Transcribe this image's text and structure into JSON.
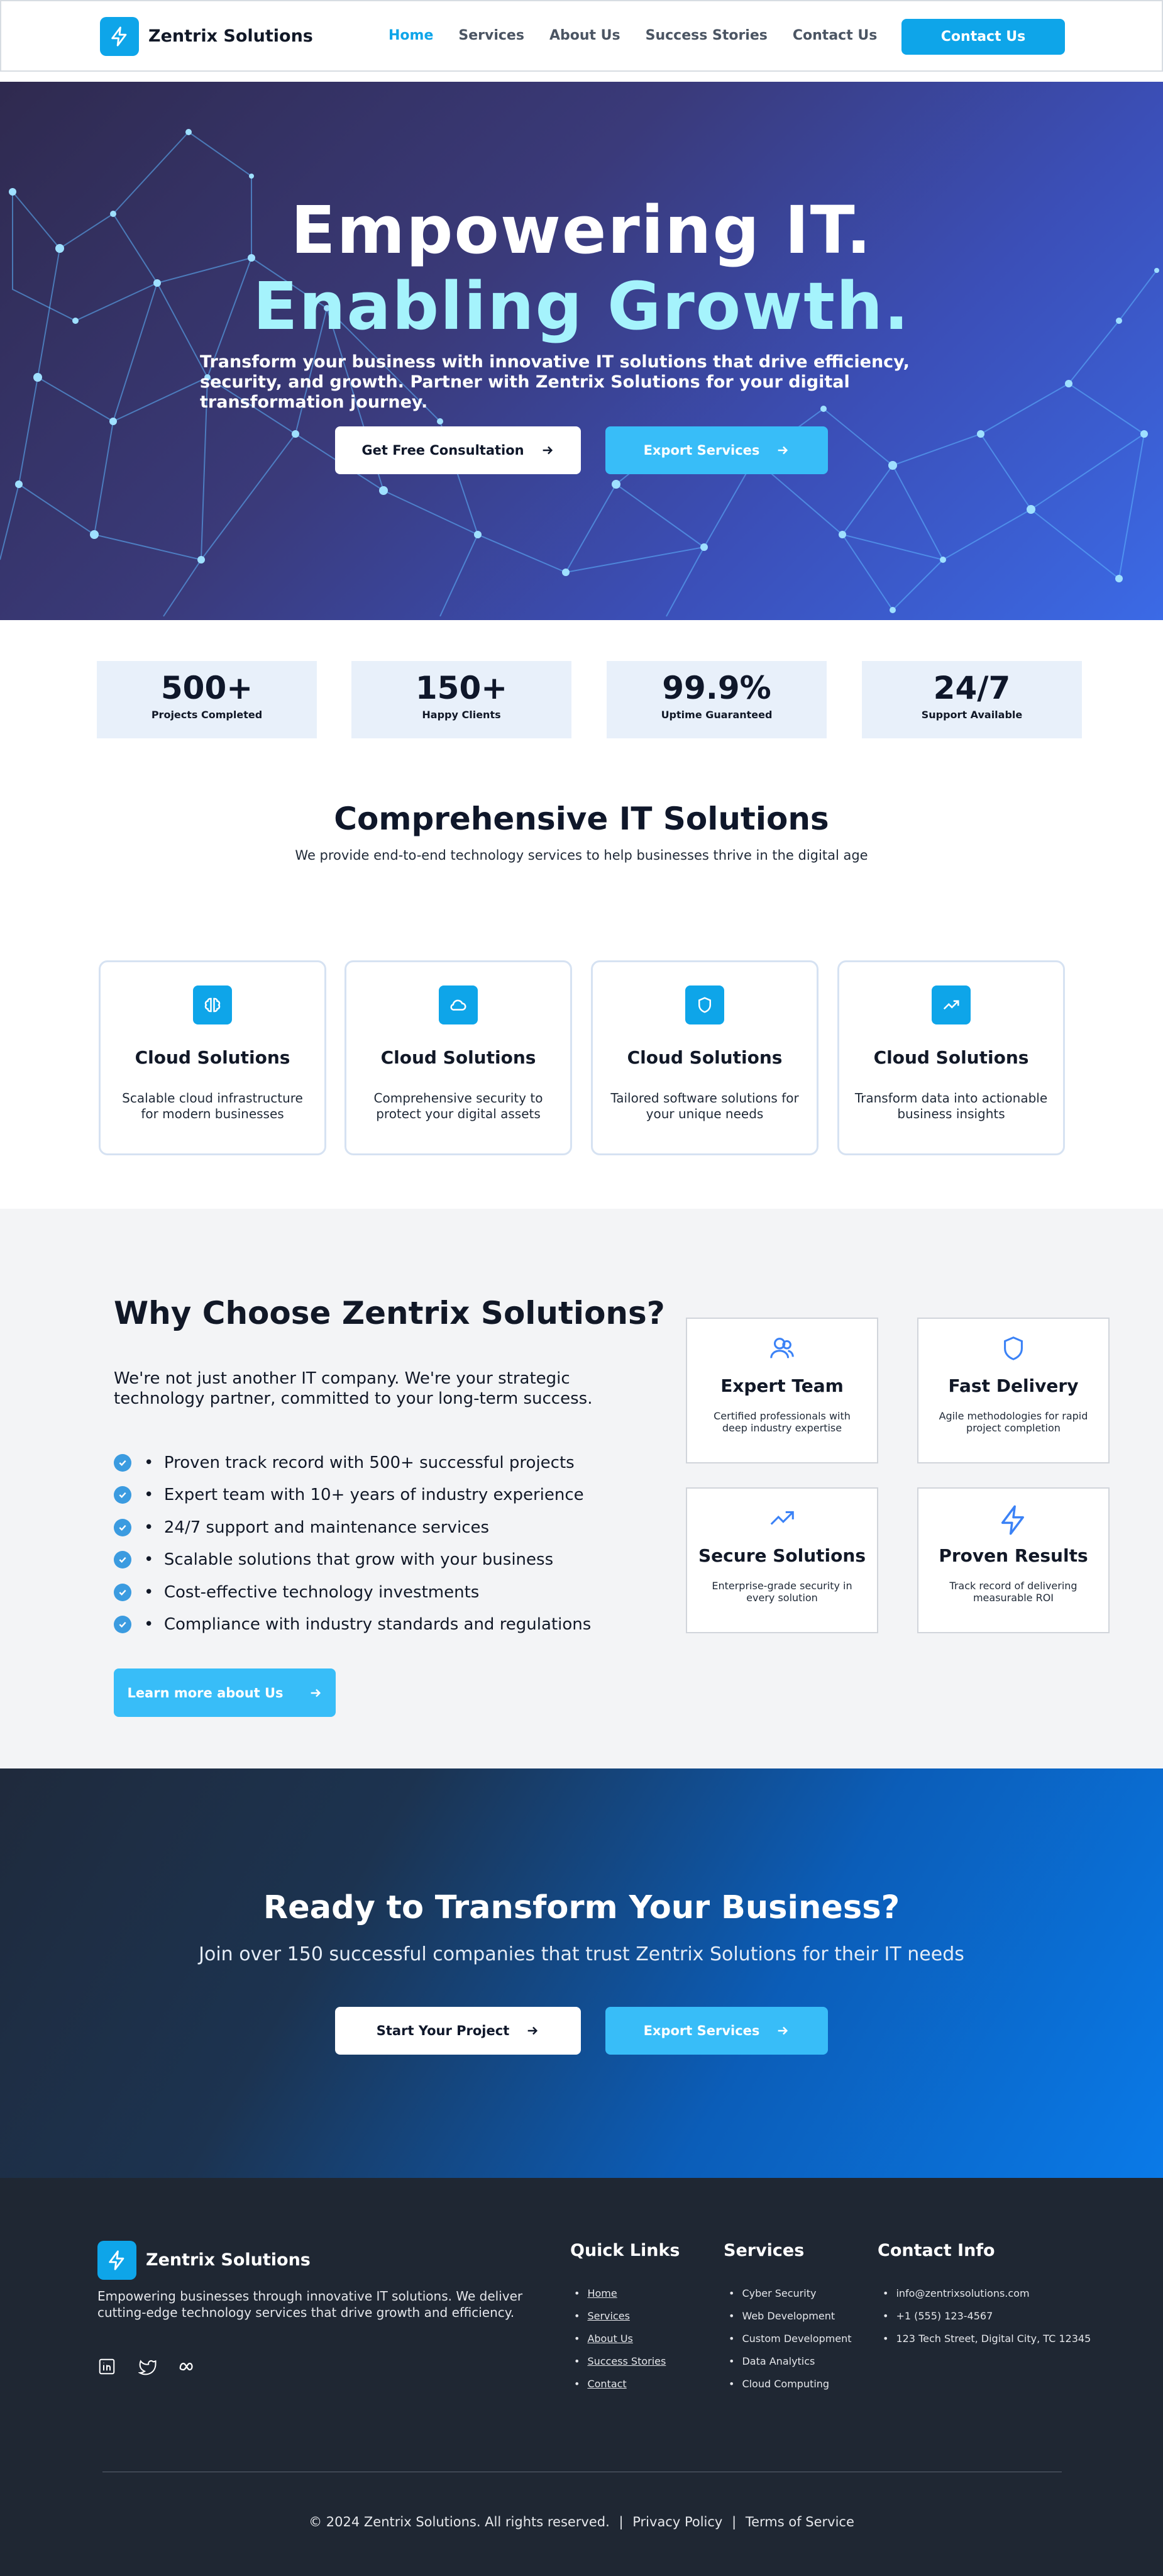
{
  "nav": {
    "brand": "Zentrix Solutions",
    "links": [
      "Home",
      "Services",
      "About Us",
      "Success Stories",
      "Contact Us"
    ],
    "cta": "Contact Us"
  },
  "hero": {
    "title_line1": "Empowering IT.",
    "title_line2": "Enabling Growth.",
    "subtitle": "Transform your business with innovative IT solutions that drive efficiency, security, and growth. Partner with Zentrix Solutions for your digital transformation journey.",
    "primary_button": "Get Free Consultation",
    "secondary_button": "Export Services"
  },
  "stats": [
    {
      "value": "500+",
      "label": "Projects Completed"
    },
    {
      "value": "150+",
      "label": "Happy Clients"
    },
    {
      "value": "99.9%",
      "label": "Uptime Guaranteed"
    },
    {
      "value": "24/7",
      "label": "Support Available"
    }
  ],
  "services": {
    "title": "Comprehensive IT Solutions",
    "subtitle": "We provide end-to-end technology services to help businesses thrive in the digital age",
    "cards": [
      {
        "title": "Cloud Solutions",
        "desc": "Scalable cloud infrastructure for modern businesses",
        "icon": "brain-icon"
      },
      {
        "title": "Cloud Solutions",
        "desc": "Comprehensive security to protect your digital assets",
        "icon": "cloud-icon"
      },
      {
        "title": "Cloud Solutions",
        "desc": "Tailored software solutions for your unique needs",
        "icon": "shield-icon"
      },
      {
        "title": "Cloud Solutions",
        "desc": "Transform data into actionable business insights",
        "icon": "trend-icon"
      }
    ]
  },
  "why": {
    "title": "Why Choose Zentrix Solutions?",
    "text": "We're not just another IT company. We're your strategic technology partner, committed to your long-term success.",
    "points": [
      "Proven track record with 500+ successful projects",
      "Expert team with 10+ years of industry experience",
      "24/7 support and maintenance services",
      "Scalable solutions that grow with your business",
      "Cost-effective technology investments",
      "Compliance with industry standards and regulations"
    ],
    "button": "Learn more about Us",
    "features": [
      {
        "title": "Expert Team",
        "desc": "Certified professionals with deep industry expertise",
        "icon": "users-icon"
      },
      {
        "title": "Fast Delivery",
        "desc": "Agile methodologies for rapid project completion",
        "icon": "shield-icon"
      },
      {
        "title": "Secure Solutions",
        "desc": "Enterprise-grade security in every solution",
        "icon": "trend-icon"
      },
      {
        "title": "Proven Results",
        "desc": "Track record of delivering measurable ROI",
        "icon": "lightning-icon"
      }
    ]
  },
  "cta": {
    "title": "Ready to Transform Your Business?",
    "subtitle": "Join over 150 successful companies that trust Zentrix Solutions for their IT needs",
    "primary_button": "Start Your Project",
    "secondary_button": "Export Services"
  },
  "footer": {
    "brand": "Zentrix Solutions",
    "desc": "Empowering businesses through innovative IT solutions. We deliver cutting-edge technology services that drive growth and efficiency.",
    "quick_links_title": "Quick Links",
    "quick_links": [
      "Home",
      "Services",
      "About Us",
      "Success Stories",
      "Contact"
    ],
    "services_title": "Services",
    "services": [
      "Cyber Security",
      "Web Development",
      "Custom Development",
      "Data Analytics",
      "Cloud Computing"
    ],
    "contact_title": "Contact Info",
    "contact": [
      "info@zentrixsolutions.com",
      "+1 (555) 123-4567",
      "123 Tech Street, Digital City, TC 12345"
    ],
    "copyright": "© 2024 Zentrix Solutions. All rights reserved.",
    "privacy": "Privacy Policy",
    "terms": "Terms of Service",
    "separator": "|"
  },
  "colors": {
    "accent": "#0ea5e9",
    "accent_light": "#38bdf8",
    "hero_highlight": "#a5f3fc",
    "footer_bg": "#1f2733"
  }
}
